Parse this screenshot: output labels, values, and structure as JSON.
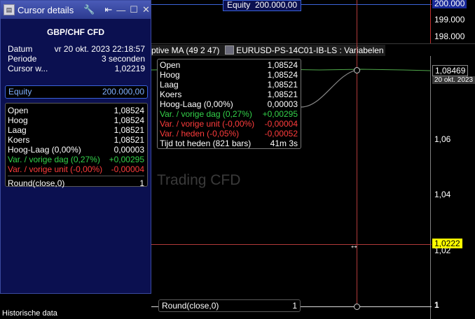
{
  "panel": {
    "title": "Cursor details",
    "instrument": "GBP/CHF CFD",
    "rows": [
      {
        "label": "Datum",
        "value": "vr 20 okt. 2023 22:18:57"
      },
      {
        "label": "Periode",
        "value": "3 seconden"
      },
      {
        "label": "Cursor w...",
        "value": "1,02219"
      }
    ],
    "equity_label": "Equity",
    "equity_value": "200.000,00",
    "stats": [
      {
        "label": "Open",
        "value": "1,08524"
      },
      {
        "label": "Hoog",
        "value": "1,08524"
      },
      {
        "label": "Laag",
        "value": "1,08521"
      },
      {
        "label": "Koers",
        "value": "1,08521"
      },
      {
        "label": "Hoog-Laag (0,00%)",
        "value": "0,00003"
      }
    ],
    "var_day": {
      "label": "Var. / vorige dag (0,27%)",
      "value": "+0,00295"
    },
    "var_unit": {
      "label": "Var. / vorige unit (-0,00%)",
      "value": "-0,00004"
    },
    "round_label": "Round(close,0)",
    "round_value": "1"
  },
  "status_bar": "Historische data",
  "top_equity": {
    "label": "Equity",
    "value": "200.000,00"
  },
  "top_axis": [
    "200.000",
    "199.000",
    "198.000"
  ],
  "chart_header": {
    "left": "ptive MA (49 2 47)",
    "right": "EURUSD-PS-14C01-IB-LS : Variabelen"
  },
  "watermark": "Trading CFD",
  "tooltip": {
    "rows": [
      {
        "label": "Open",
        "value": "1,08524"
      },
      {
        "label": "Hoog",
        "value": "1,08524"
      },
      {
        "label": "Laag",
        "value": "1,08521"
      },
      {
        "label": "Koers",
        "value": "1,08521"
      },
      {
        "label": "Hoog-Laag (0,00%)",
        "value": "0,00003"
      }
    ],
    "var_day": {
      "label": "Var. / vorige dag (0,27%)",
      "value": "+0,00295"
    },
    "var_unit": {
      "label": "Var. / vorige unit (-0,00%)",
      "value": "-0,00004"
    },
    "var_today": {
      "label": "Var. / heden (-0,05%)",
      "value": "-0,00052"
    },
    "time": {
      "label": "Tijd tot heden (821 bars)",
      "value": "41m 3s"
    }
  },
  "price_axis": {
    "current": "1,08469",
    "date_tag": "20 okt. 2023",
    "ticks": [
      "1,06",
      "1,04",
      "1,02"
    ],
    "cursor_value": "1,0222"
  },
  "bottom_indicator": {
    "label": "Round(close,0)",
    "value": "1",
    "axis": "1"
  },
  "colors": {
    "panel_bg": "#0b1050",
    "title_grad": "#4a5bb8",
    "green": "#33d24a",
    "red": "#ff3c3c",
    "cursor_tag": "#ffff00"
  }
}
